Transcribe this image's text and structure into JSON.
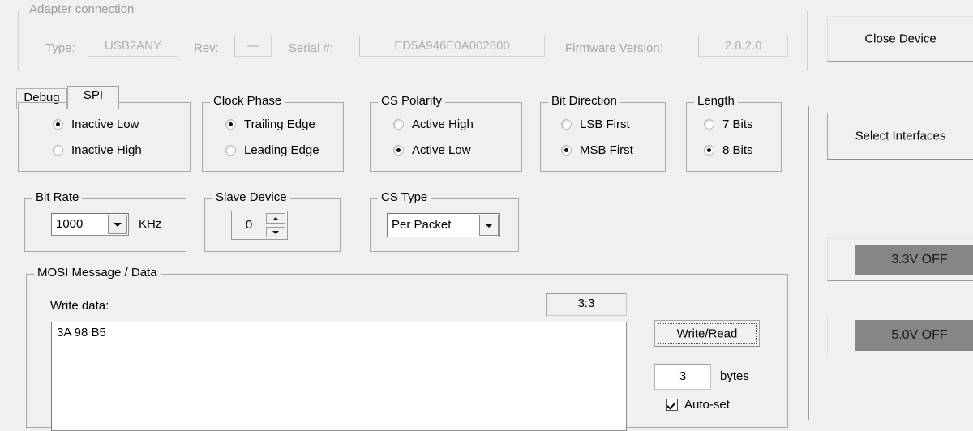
{
  "adapter": {
    "title": "Adapter connection",
    "type_label": "Type:",
    "type_value": "USB2ANY",
    "rev_label": "Rev:",
    "rev_value": "---",
    "serial_label": "Serial #:",
    "serial_value": "ED5A946E0A002800",
    "firmware_label": "Firmware Version:",
    "firmware_value": "2.8.2.0"
  },
  "tabs": [
    {
      "label": "Debug",
      "active": false
    },
    {
      "label": "SPI",
      "active": true
    }
  ],
  "groups": {
    "clock_polarity": {
      "title": "",
      "options": [
        {
          "label": "Inactive Low",
          "selected": true
        },
        {
          "label": "Inactive High",
          "selected": false
        }
      ]
    },
    "clock_phase": {
      "title": "Clock Phase",
      "options": [
        {
          "label": "Trailing Edge",
          "selected": true
        },
        {
          "label": "Leading Edge",
          "selected": false
        }
      ]
    },
    "cs_polarity": {
      "title": "CS Polarity",
      "options": [
        {
          "label": "Active High",
          "selected": false
        },
        {
          "label": "Active Low",
          "selected": true
        }
      ]
    },
    "bit_direction": {
      "title": "Bit Direction",
      "options": [
        {
          "label": "LSB First",
          "selected": false
        },
        {
          "label": "MSB First",
          "selected": true
        }
      ]
    },
    "length": {
      "title": "Length",
      "options": [
        {
          "label": "7 Bits",
          "selected": false
        },
        {
          "label": "8 Bits",
          "selected": true
        }
      ]
    },
    "bit_rate": {
      "title": "Bit Rate",
      "value": "1000",
      "unit": "KHz"
    },
    "slave_device": {
      "title": "Slave Device",
      "value": "0"
    },
    "cs_type": {
      "title": "CS Type",
      "value": "Per Packet"
    }
  },
  "mosi": {
    "title": "MOSI Message / Data",
    "write_data_label": "Write data:",
    "counter_value": "3:3",
    "write_data_value": "3A 98 B5",
    "write_read_button": "Write/Read",
    "bytes_value": "3",
    "bytes_label": "bytes",
    "autoset_label": "Auto-set",
    "autoset_checked": true
  },
  "side_buttons": [
    {
      "label": "Close Device"
    },
    {
      "label": "Select Interfaces"
    },
    {
      "label": "3.3V OFF"
    },
    {
      "label": "5.0V OFF"
    }
  ],
  "colors": {
    "window_bg": "#f0f0f0",
    "voltage_off_bg": "#868686",
    "field_border": "#8b8b8b",
    "disabled_text": "#a6a6a6"
  }
}
